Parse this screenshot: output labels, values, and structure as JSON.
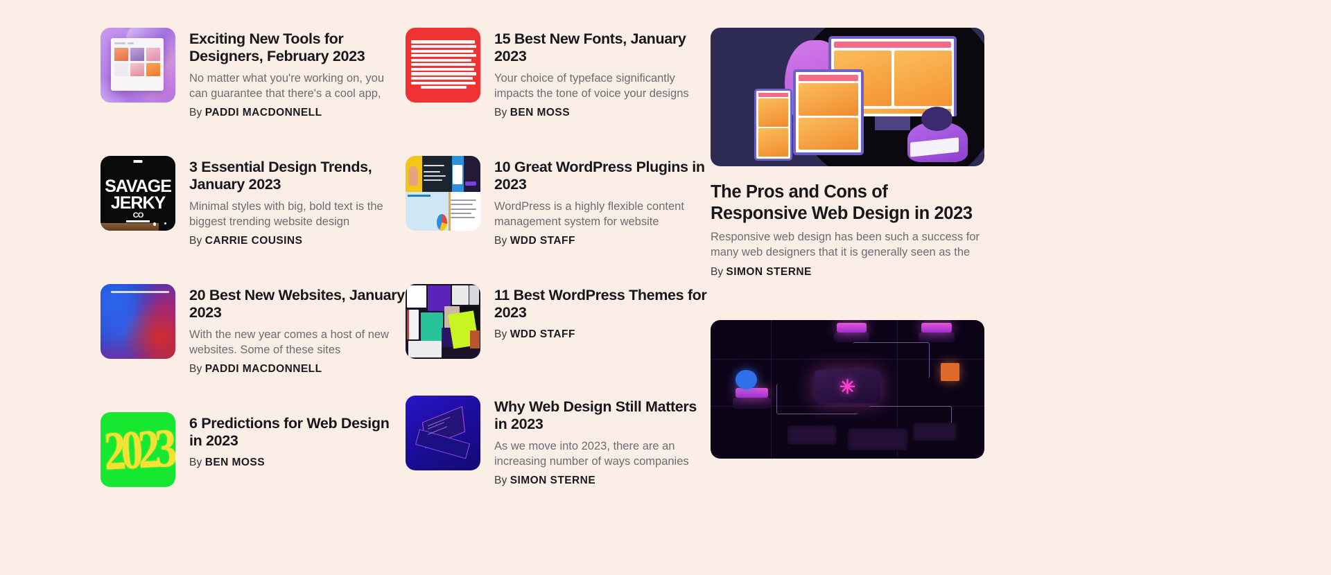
{
  "page": {
    "background_color": "#faeee7"
  },
  "columns": {
    "left": [
      {
        "title": "Exciting New Tools for Designers, February 2023",
        "excerpt": "No matter what you're working on, you can guarantee that there's a cool app,",
        "by_prefix": "By",
        "author": "PADDI MACDONNELL",
        "thumb_name": "purple-design-tools-thumbnail"
      },
      {
        "title": "3 Essential Design Trends, January 2023",
        "excerpt": "Minimal styles with big, bold text is the biggest trending website design",
        "by_prefix": "By",
        "author": "CARRIE COUSINS",
        "thumb_name": "savage-jerky-black-thumbnail",
        "thumb_text_line1": "SAVAGE",
        "thumb_text_line2": "JERKY",
        "thumb_text_sup": "CO"
      },
      {
        "title": "20 Best New Websites, January 2023",
        "excerpt": "With the new year comes a host of new websites. Some of these sites",
        "by_prefix": "By",
        "author": "PADDI MACDONNELL",
        "thumb_name": "blue-red-smoke-thumbnail"
      },
      {
        "title": "6 Predictions for Web Design in 2023",
        "excerpt": "",
        "by_prefix": "By",
        "author": "BEN MOSS",
        "thumb_name": "green-graffiti-2023-thumbnail",
        "thumb_text": "2023"
      }
    ],
    "middle": [
      {
        "title": "15 Best New Fonts, January 2023",
        "excerpt": "Your choice of typeface significantly impacts the tone of voice your designs",
        "by_prefix": "By",
        "author": "BEN MOSS",
        "thumb_name": "red-typography-poster-thumbnail"
      },
      {
        "title": "10 Great WordPress Plugins in 2023",
        "excerpt": "WordPress is a highly flexible content management system for website",
        "by_prefix": "By",
        "author": "WDD STAFF",
        "thumb_name": "wordpress-plugins-collage-thumbnail"
      },
      {
        "title": "11 Best WordPress Themes for 2023",
        "excerpt": "",
        "by_prefix": "By",
        "author": "WDD STAFF",
        "thumb_name": "wordpress-themes-collage-thumbnail"
      },
      {
        "title": "Why Web Design Still Matters in 2023",
        "excerpt": "As we move into 2023, there are an increasing number of ways companies",
        "by_prefix": "By",
        "author": "SIMON STERNE",
        "thumb_name": "isometric-laptop-thumbnail"
      }
    ],
    "right": [
      {
        "title": "The Pros and Cons of Responsive Web Design in 2023",
        "excerpt": "Responsive web design has been such a success for many web designers that it is generally seen as the",
        "by_prefix": "By",
        "author": "SIMON STERNE",
        "image_name": "responsive-devices-illustration"
      },
      {
        "title": "",
        "excerpt": "",
        "by_prefix": "",
        "author": "",
        "image_name": "network-nodes-illustration"
      }
    ]
  }
}
